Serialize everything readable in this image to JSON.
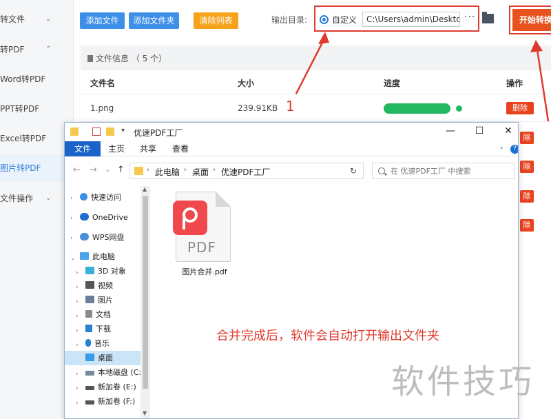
{
  "sidebar": {
    "items": [
      {
        "label": "转文件",
        "chevron": "⌄"
      },
      {
        "label": "转PDF",
        "chevron": "⌃"
      },
      {
        "label": "Word转PDF"
      },
      {
        "label": "PPT转PDF"
      },
      {
        "label": "Excel转PDF"
      },
      {
        "label": "图片转PDF"
      },
      {
        "label": "文件操作",
        "chevron": "⌄"
      }
    ]
  },
  "toolbar": {
    "add_file": "添加文件",
    "add_folder": "添加文件夹",
    "clear_list": "清除列表",
    "output_label": "输出目录:",
    "custom_label": "自定义",
    "path_value": "C:\\Users\\admin\\Deskto",
    "more": "···",
    "start": "开始转换"
  },
  "file_info": {
    "title": "文件信息 （ 5 个）",
    "headers": {
      "name": "文件名",
      "size": "大小",
      "progress": "进度",
      "action": "操作"
    },
    "rows": [
      {
        "name": "1.png",
        "size": "239.91KB",
        "progress": 1.0,
        "action": "删除"
      }
    ],
    "hidden_actions": [
      "除",
      "除",
      "除",
      "除"
    ]
  },
  "annotation": {
    "number": "1"
  },
  "explorer": {
    "title": "优速PDF工厂",
    "tabs": {
      "file": "文件",
      "home": "主页",
      "share": "共享",
      "view": "查看"
    },
    "controls": {
      "min": "—",
      "max": "☐",
      "close": "✕"
    },
    "breadcrumb": [
      "此电脑",
      "桌面",
      "优速PDF工厂"
    ],
    "search_placeholder": "在 优速PDF工厂 中搜索",
    "nav": [
      {
        "label": "快速访问"
      },
      {
        "label": "OneDrive"
      },
      {
        "label": "WPS网盘"
      },
      {
        "label": "此电脑"
      },
      {
        "label": "3D 对象"
      },
      {
        "label": "视频"
      },
      {
        "label": "图片"
      },
      {
        "label": "文档"
      },
      {
        "label": "下载"
      },
      {
        "label": "音乐"
      },
      {
        "label": "桌面"
      },
      {
        "label": "本地磁盘 (C:)"
      },
      {
        "label": "新加卷 (E:)"
      },
      {
        "label": "新加卷 (F:)"
      }
    ],
    "file": {
      "name": "图片合并.pdf",
      "badge_text": "PDF"
    },
    "note": "合并完成后，软件会自动打开输出文件夹"
  },
  "watermark": "软件技巧",
  "colors": {
    "accent_blue": "#3d8fe8",
    "accent_orange": "#f7a21b",
    "start_red": "#e8521f",
    "annotation_red": "#e03a2e",
    "progress_green": "#22b761"
  }
}
